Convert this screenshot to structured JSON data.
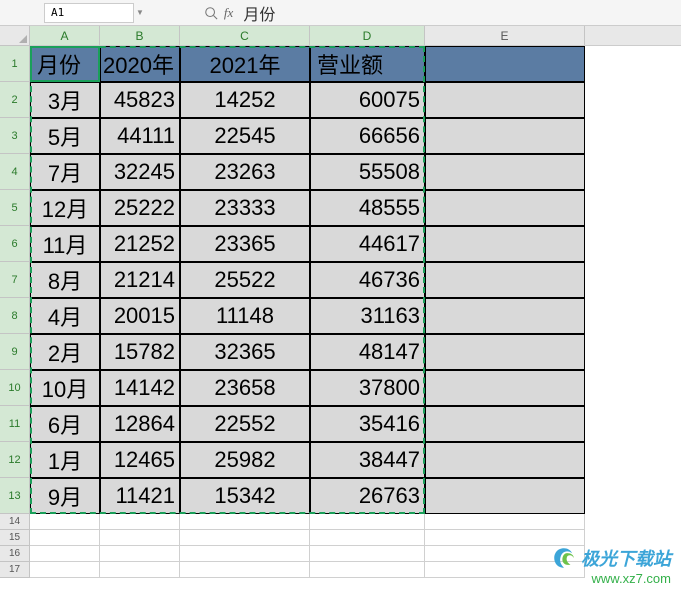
{
  "formula_bar": {
    "cell_ref": "A1",
    "fx_label": "fx",
    "formula_value": "月份"
  },
  "columns": [
    {
      "letter": "A",
      "selected": true
    },
    {
      "letter": "B",
      "selected": true
    },
    {
      "letter": "C",
      "selected": true
    },
    {
      "letter": "D",
      "selected": true
    },
    {
      "letter": "E",
      "selected": false
    }
  ],
  "table": {
    "headers": {
      "month": "月份",
      "y2020": "2020年",
      "y2021": "2021年",
      "revenue": "营业额"
    },
    "rows": [
      {
        "month": "3月",
        "y2020": "45823",
        "y2021": "14252",
        "revenue": "60075"
      },
      {
        "month": "5月",
        "y2020": "44111",
        "y2021": "22545",
        "revenue": "66656"
      },
      {
        "month": "7月",
        "y2020": "32245",
        "y2021": "23263",
        "revenue": "55508"
      },
      {
        "month": "12月",
        "y2020": "25222",
        "y2021": "23333",
        "revenue": "48555"
      },
      {
        "month": "11月",
        "y2020": "21252",
        "y2021": "23365",
        "revenue": "44617"
      },
      {
        "month": "8月",
        "y2020": "21214",
        "y2021": "25522",
        "revenue": "46736"
      },
      {
        "month": "4月",
        "y2020": "20015",
        "y2021": "11148",
        "revenue": "31163"
      },
      {
        "month": "2月",
        "y2020": "15782",
        "y2021": "32365",
        "revenue": "48147"
      },
      {
        "month": "10月",
        "y2020": "14142",
        "y2021": "23658",
        "revenue": "37800"
      },
      {
        "month": "6月",
        "y2020": "12864",
        "y2021": "22552",
        "revenue": "35416"
      },
      {
        "month": "1月",
        "y2020": "12465",
        "y2021": "25982",
        "revenue": "38447"
      },
      {
        "month": "9月",
        "y2020": "11421",
        "y2021": "15342",
        "revenue": "26763"
      }
    ]
  },
  "empty_rows": [
    "14",
    "15",
    "16",
    "17"
  ],
  "row_numbers_selected": [
    "1",
    "2",
    "3",
    "4",
    "5",
    "6",
    "7",
    "8",
    "9",
    "10",
    "11",
    "12",
    "13"
  ],
  "watermark": {
    "title": "极光下载站",
    "url": "www.xz7.com"
  }
}
